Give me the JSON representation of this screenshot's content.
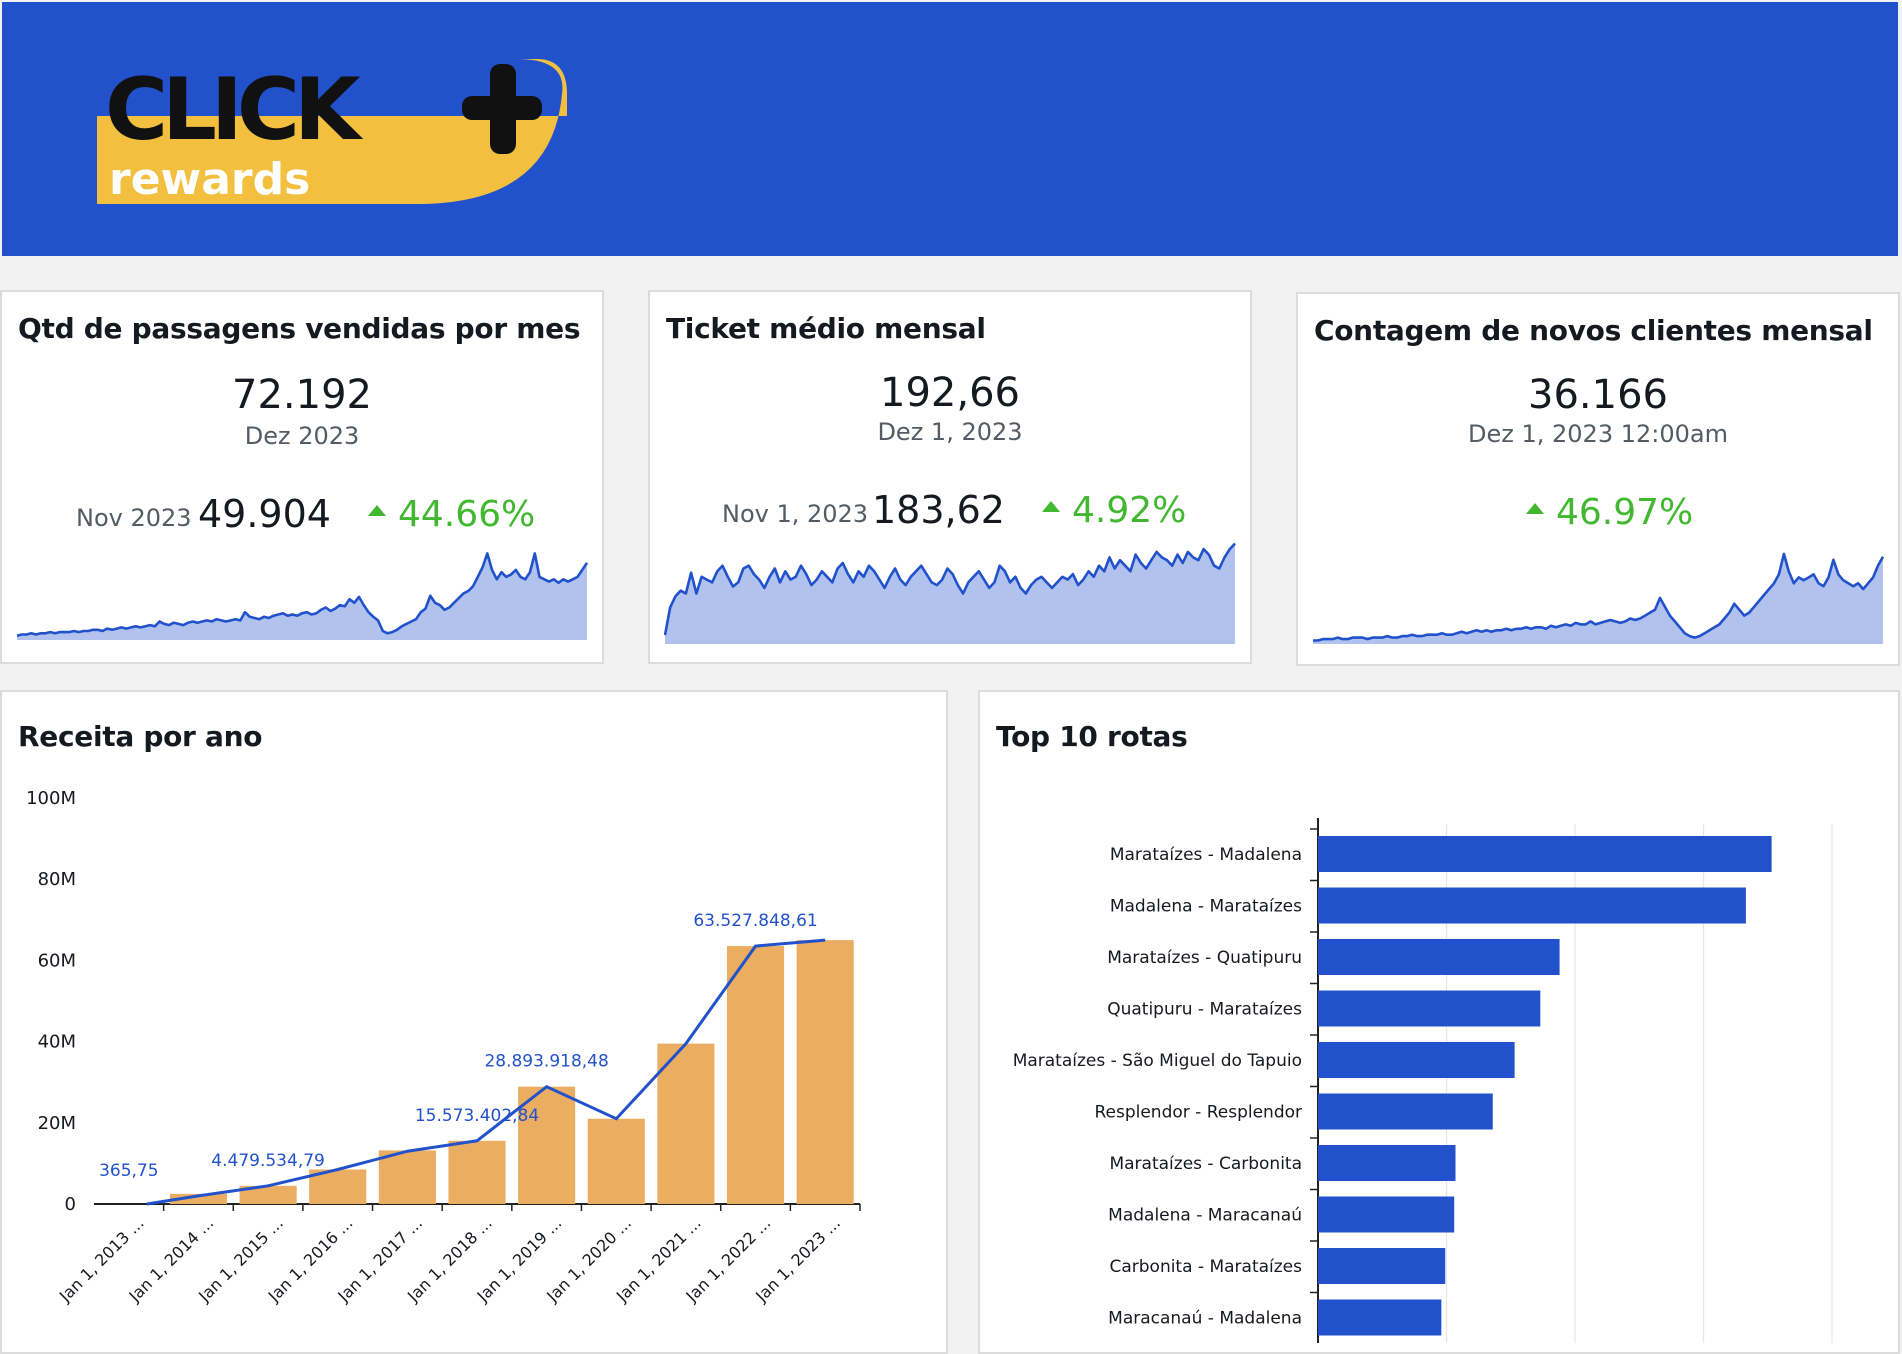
{
  "header": {
    "logo_text": "CLICK",
    "logo_subtext": "rewards",
    "bg_color": "#2152cc",
    "logo_accent": "#f2bf3f"
  },
  "kpis": [
    {
      "title": "Qtd de passagens vendidas por mes",
      "value": "72.192",
      "period": "Dez 2023",
      "compare_label": "Nov 2023",
      "compare_value": "49.904",
      "delta": "44.66%",
      "sparkline": [
        2,
        3,
        3,
        4,
        3,
        4,
        4,
        5,
        4,
        5,
        5,
        5,
        6,
        5,
        6,
        6,
        7,
        7,
        6,
        8,
        7,
        8,
        9,
        8,
        9,
        10,
        9,
        10,
        11,
        10,
        14,
        12,
        11,
        13,
        12,
        11,
        13,
        14,
        13,
        14,
        15,
        14,
        16,
        15,
        14,
        15,
        16,
        15,
        22,
        18,
        17,
        16,
        18,
        17,
        19,
        20,
        21,
        19,
        20,
        19,
        21,
        22,
        20,
        21,
        24,
        26,
        23,
        25,
        28,
        27,
        33,
        30,
        35,
        28,
        22,
        18,
        15,
        6,
        4,
        5,
        7,
        10,
        12,
        14,
        16,
        22,
        25,
        36,
        30,
        28,
        24,
        26,
        30,
        34,
        38,
        40,
        44,
        52,
        60,
        72,
        58,
        50,
        56,
        52,
        54,
        58,
        52,
        50,
        56,
        72,
        52,
        50,
        48,
        50,
        47,
        50,
        48,
        50,
        52,
        58,
        64
      ],
      "spark_ymax": 80
    },
    {
      "title": "Ticket médio mensal",
      "value": "192,66",
      "period": "Dez 1, 2023",
      "compare_label": "Nov 1, 2023",
      "compare_value": "183,62",
      "delta": "4.92%",
      "sparkline": [
        130,
        150,
        158,
        162,
        160,
        175,
        160,
        172,
        170,
        168,
        176,
        180,
        172,
        165,
        168,
        178,
        180,
        174,
        170,
        164,
        172,
        178,
        168,
        176,
        170,
        172,
        180,
        174,
        166,
        170,
        176,
        172,
        168,
        178,
        182,
        174,
        168,
        176,
        172,
        180,
        176,
        170,
        164,
        172,
        178,
        170,
        166,
        172,
        176,
        180,
        174,
        168,
        166,
        170,
        178,
        174,
        166,
        160,
        168,
        172,
        176,
        170,
        164,
        168,
        180,
        176,
        168,
        172,
        164,
        160,
        166,
        170,
        172,
        168,
        164,
        168,
        172,
        170,
        174,
        166,
        170,
        176,
        172,
        180,
        176,
        186,
        178,
        184,
        180,
        176,
        188,
        182,
        178,
        184,
        190,
        186,
        184,
        180,
        188,
        182,
        190,
        186,
        184,
        192,
        188,
        180,
        178,
        186,
        192,
        196
      ],
      "spark_ymax": 200,
      "spark_ymin": 125
    },
    {
      "title": "Contagem de novos clientes mensal",
      "value": "36.166",
      "period": "Dez 1, 2023 12:00am",
      "compare_label": "",
      "compare_value": "",
      "delta": "46.97%",
      "sparkline": [
        1,
        1,
        2,
        2,
        2,
        3,
        2,
        2,
        3,
        3,
        3,
        2,
        3,
        3,
        3,
        4,
        3,
        3,
        4,
        4,
        5,
        4,
        4,
        5,
        5,
        5,
        6,
        5,
        5,
        6,
        7,
        6,
        7,
        8,
        7,
        8,
        7,
        8,
        8,
        9,
        8,
        9,
        9,
        10,
        9,
        10,
        10,
        9,
        11,
        10,
        11,
        12,
        11,
        13,
        12,
        12,
        14,
        12,
        13,
        14,
        15,
        14,
        13,
        14,
        16,
        15,
        16,
        18,
        20,
        22,
        30,
        24,
        18,
        14,
        10,
        6,
        4,
        3,
        4,
        6,
        8,
        10,
        12,
        16,
        20,
        26,
        22,
        18,
        20,
        24,
        28,
        32,
        36,
        40,
        46,
        60,
        48,
        40,
        44,
        42,
        44,
        46,
        40,
        38,
        44,
        56,
        46,
        42,
        40,
        38,
        40,
        36,
        40,
        44,
        52,
        58
      ],
      "spark_ymax": 64
    }
  ],
  "revenue_card": {
    "title": "Receita por ano"
  },
  "routes_card": {
    "title": "Top 10 rotas"
  },
  "chart_data": [
    {
      "type": "bar",
      "title": "Receita por ano",
      "categories": [
        "Jan 1, 2013 ...",
        "Jan 1, 2014 ...",
        "Jan 1, 2015 ...",
        "Jan 1, 2016 ...",
        "Jan 1, 2017 ...",
        "Jan 1, 2018 ...",
        "Jan 1, 2019 ...",
        "Jan 1, 2020 ...",
        "Jan 1, 2021 ...",
        "Jan 1, 2022 ...",
        "Jan 1, 2023 ..."
      ],
      "series": [
        {
          "type": "bar",
          "values": [
            365.75,
            2500000,
            4479534.79,
            8500000,
            13200000,
            15573402.84,
            28893918.48,
            21000000,
            39500000,
            63527848.61,
            65000000
          ]
        },
        {
          "type": "line",
          "values": [
            365.75,
            2000000,
            4479534.79,
            8500000,
            13000000,
            15573402.84,
            28893918.48,
            21000000,
            39500000,
            63527848.61,
            65000000
          ]
        }
      ],
      "data_labels": [
        {
          "index": 0,
          "text": "365,75"
        },
        {
          "index": 2,
          "text": "4.479.534,79"
        },
        {
          "index": 5,
          "text": "15.573.402,84"
        },
        {
          "index": 6,
          "text": "28.893.918,48"
        },
        {
          "index": 9,
          "text": "63.527.848,61"
        }
      ],
      "yticks": [
        "0",
        "20M",
        "40M",
        "60M",
        "80M",
        "100M"
      ],
      "ylim": [
        0,
        100000000
      ],
      "bar_color": "#ebad62",
      "line_color": "#2152cc"
    },
    {
      "type": "bar",
      "orientation": "horizontal",
      "title": "Top 10 rotas",
      "categories": [
        "Marataízes - Madalena",
        "Madalena - Marataízes",
        "Marataízes - Quatipuru",
        "Quatipuru - Marataízes",
        "Marataízes - São Miguel do Tapuio",
        "Resplendor - Resplendor",
        "Marataízes - Carbonita",
        "Madalena - Maracanaú",
        "Carbonita - Marataízes",
        "Maracanaú - Madalena"
      ],
      "values": [
        35300,
        33300,
        18800,
        17300,
        15300,
        13600,
        10700,
        10600,
        9900,
        9600
      ],
      "xticks": [
        "0",
        "10K",
        "20K",
        "30K",
        "40K"
      ],
      "xlim": [
        0,
        40000
      ],
      "bar_color": "#2152cc",
      "grid": true
    }
  ]
}
